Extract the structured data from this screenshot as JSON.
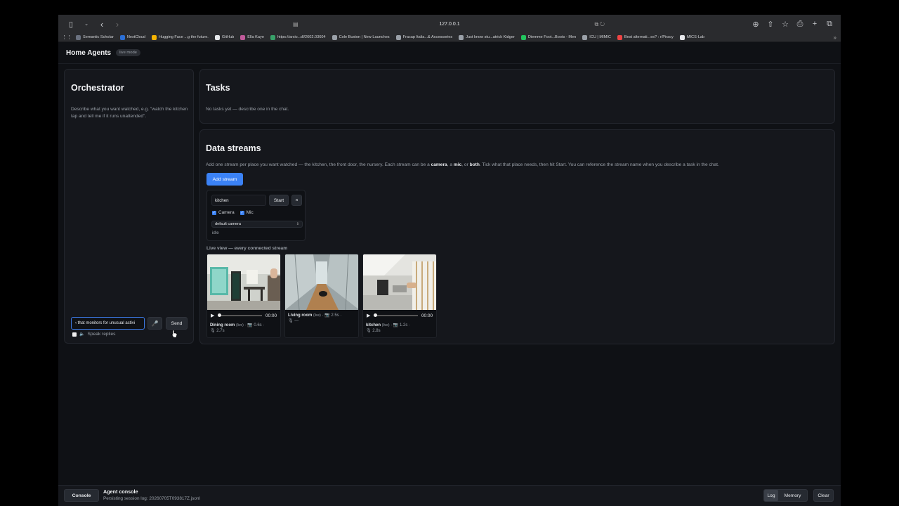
{
  "browser": {
    "url": "127.0.0.1",
    "bookmarks": [
      {
        "label": "Semantic Scholar",
        "color": "#6b7280"
      },
      {
        "label": "NextCloud",
        "color": "#2b6fd6"
      },
      {
        "label": "Hugging Face ...g the future.",
        "color": "#f5b301"
      },
      {
        "label": "GitHub",
        "color": "#e6e8eb"
      },
      {
        "label": "Ella Kaye",
        "color": "#c05a9a"
      },
      {
        "label": "https://arxiv...df/2602.03604",
        "color": "#38a169"
      },
      {
        "label": "Cole Buxton | New Launches",
        "color": "#9aa0a8"
      },
      {
        "label": "Fracap Italia...& Accessories",
        "color": "#9aa0a8"
      },
      {
        "label": "Just know stu...atrick Kidger",
        "color": "#9aa0a8"
      },
      {
        "label": "Diemme Foot...Boots - Men",
        "color": "#22c55e"
      },
      {
        "label": "ICU | MIMIC",
        "color": "#9aa0a8"
      },
      {
        "label": "Best alternati...es? : r/Piracy",
        "color": "#ef4444"
      },
      {
        "label": "MICS-Lab",
        "color": "#e6e8eb"
      }
    ]
  },
  "header": {
    "title": "Home Agents",
    "badge": "live mode"
  },
  "orchestrator": {
    "title": "Orchestrator",
    "hint": "Describe what you want watched, e.g. \"watch the kitchen tap and tell me if it runs unattended\".",
    "input_value": "‹ that monitors for unusual activi",
    "send_label": "Send",
    "speak_label": "Speak replies"
  },
  "tasks": {
    "title": "Tasks",
    "empty": "No tasks yet — describe one in the chat."
  },
  "streams": {
    "title": "Data streams",
    "desc_1": "Add one stream per place you want watched — the kitchen, the front door, the nursery. Each stream can be a ",
    "desc_camera": "camera",
    "desc_2": ", a ",
    "desc_mic": "mic",
    "desc_3": ", or ",
    "desc_both": "both",
    "desc_4": ". Tick what that place needs, then hit Start. You can reference the stream name when you describe a task in the chat.",
    "add_label": "Add stream",
    "card": {
      "name": "kitchen",
      "start_label": "Start",
      "close_label": "×",
      "camera_label": "Camera",
      "mic_label": "Mic",
      "device": "default camera",
      "state": "idle"
    },
    "live_label": "Live view — every connected stream",
    "tiles": [
      {
        "name": "Dining room",
        "status": "(live)",
        "meta": "· 📷 0.6s ·",
        "meta2": "🎙 2.7s",
        "time": "00:00"
      },
      {
        "name": "Living room",
        "status": "(live)",
        "meta": "· 📷 2.5s ·",
        "meta2": "🎙 —",
        "time": ""
      },
      {
        "name": "kitchen",
        "status": "(live)",
        "meta": "· 📷 1.2s ·",
        "meta2": "🎙 2.8s",
        "time": "00:00"
      }
    ]
  },
  "console": {
    "button": "Console",
    "title": "Agent console",
    "subtitle": "Persisting session log: 20260705T093817Z.jsonl",
    "tab_log": "Log",
    "tab_memory": "Memory",
    "clear": "Clear"
  }
}
